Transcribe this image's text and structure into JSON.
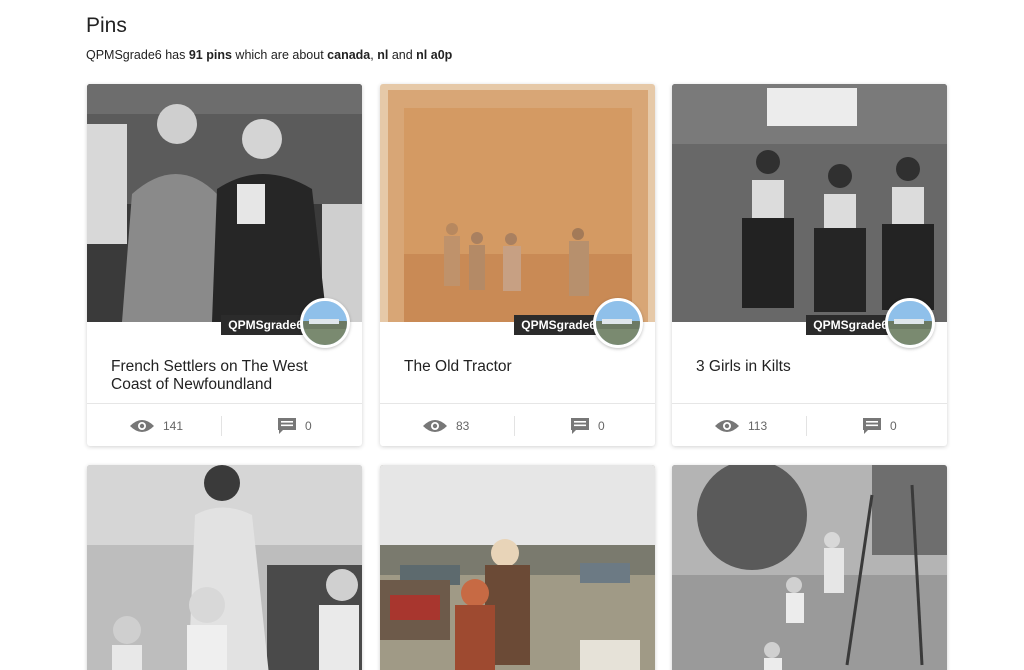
{
  "header": {
    "title": "Pins",
    "summary_user": "QPMSgrade6",
    "summary_has": "has",
    "summary_count": "91 pins",
    "summary_about": "which are about",
    "summary_tag1": "canada",
    "summary_sep": ",",
    "summary_tag2": "nl",
    "summary_and": "and",
    "summary_tag3": "nl a0p"
  },
  "pins": [
    {
      "title": "French Settlers on The West Coast of Newfoundland",
      "user": "QPMSgrade6",
      "views": "141",
      "comments": "0",
      "photo": "sepia-old-men"
    },
    {
      "title": "The Old Tractor",
      "user": "QPMSgrade6",
      "views": "83",
      "comments": "0",
      "photo": "orange-faded-group"
    },
    {
      "title": "3 Girls in Kilts",
      "user": "QPMSgrade6",
      "views": "113",
      "comments": "0",
      "photo": "bw-three-girls"
    },
    {
      "title": "",
      "user": "",
      "views": "",
      "comments": "",
      "photo": "bw-woman-children"
    },
    {
      "title": "",
      "user": "",
      "views": "",
      "comments": "",
      "photo": "color-two-children"
    },
    {
      "title": "",
      "user": "",
      "views": "",
      "comments": "",
      "photo": "bw-yard-playground"
    }
  ],
  "icons": {
    "views": "eye-icon",
    "comments": "comment-icon"
  },
  "colors": {
    "user_tag_bg": "#2b2b2b",
    "stat_text": "#666666",
    "icon_gray": "#777777"
  }
}
